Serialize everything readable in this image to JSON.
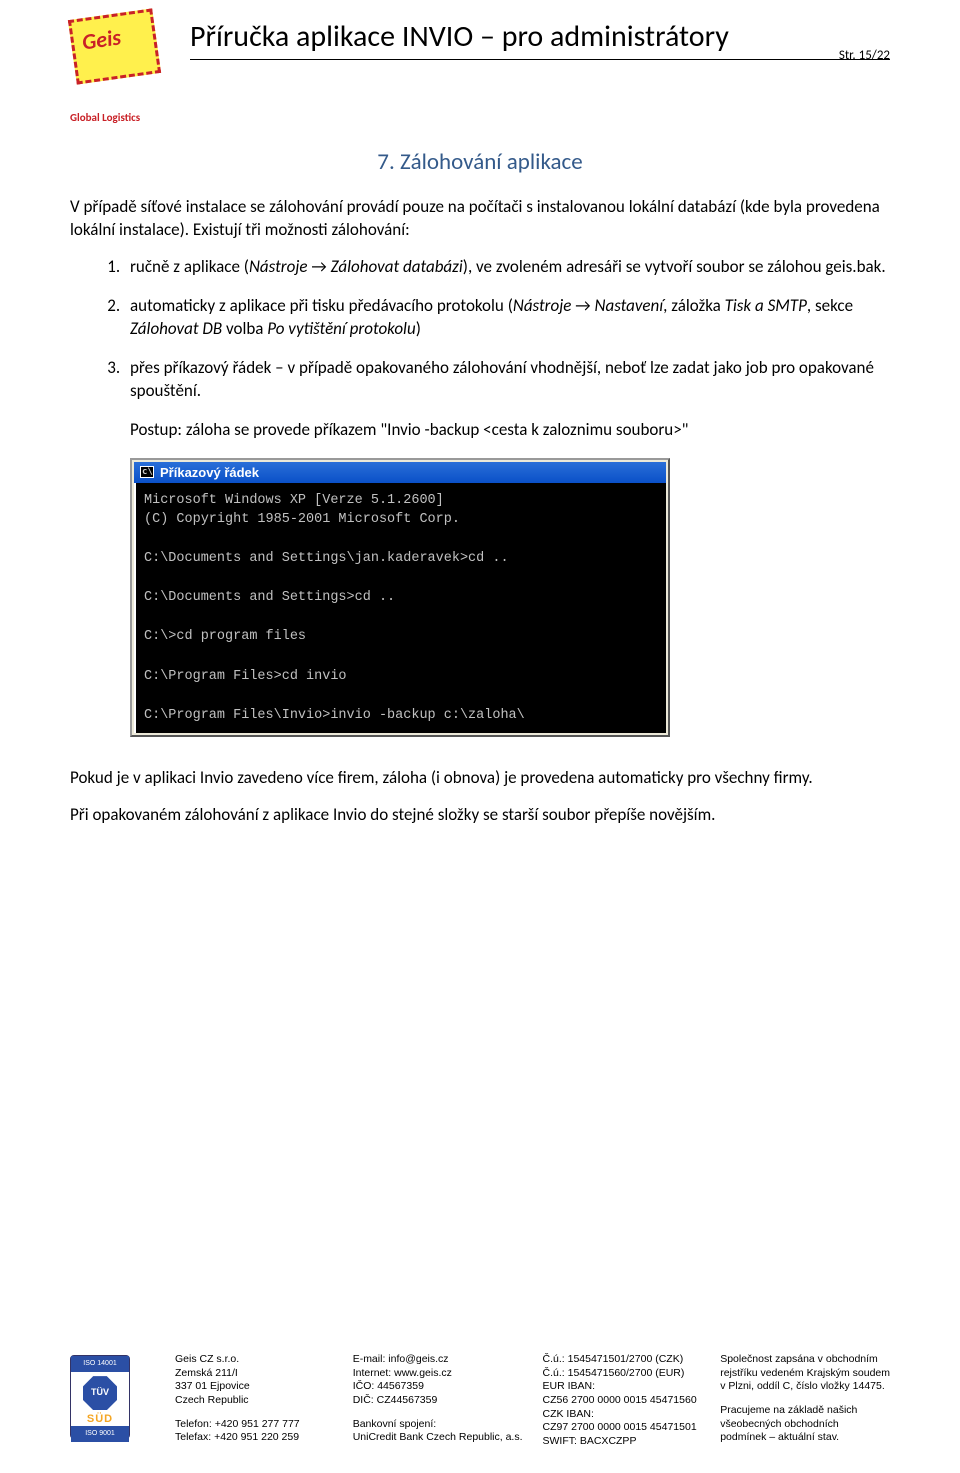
{
  "header": {
    "logo_name": "Geis",
    "logo_sub": "Global Logistics",
    "title": "Příručka aplikace INVIO – pro administrátory",
    "page_label": "Str. 15/22"
  },
  "section": {
    "heading": "7. Zálohování aplikace",
    "intro": "V případě síťové instalace se zálohování provádí pouze na počítači s instalovanou lokální databází (kde byla provedena lokální instalace). Existují tři možnosti zálohování:",
    "item1_a": "ručně z aplikace (",
    "item1_b": "Nástroje",
    "item1_c": " → ",
    "item1_d": "Zálohovat databázi",
    "item1_e": "), ve zvoleném adresáři se vytvoří soubor se zálohou geis.bak.",
    "item2_a": "automaticky z aplikace při tisku předávacího protokolu (",
    "item2_b": "Nástroje",
    "item2_c": " → ",
    "item2_d": "Nastavení",
    "item2_e": ", záložka ",
    "item2_f": "Tisk a SMTP",
    "item2_g": ", sekce ",
    "item2_h": "Zálohovat DB",
    "item2_i": " volba ",
    "item2_j": "Po vytištění protokolu",
    "item2_k": ")",
    "item3": "přes příkazový řádek – v případě opakovaného zálohování vhodnější, neboť lze zadat jako job pro opakované spouštění.",
    "postup": "Postup: záloha se provede příkazem \"Invio  -backup  <cesta k zaloznimu souboru>\"",
    "after1": "Pokud je v aplikaci Invio zavedeno více firem, záloha (i obnova) je provedena automaticky pro všechny firmy.",
    "after2": "Při opakovaném zálohování z aplikace Invio do stejné složky se starší soubor přepíše novějším."
  },
  "cmd": {
    "title": "Příkazový řádek",
    "lines": "Microsoft Windows XP [Verze 5.1.2600]\n(C) Copyright 1985-2001 Microsoft Corp.\n\nC:\\Documents and Settings\\jan.kaderavek>cd ..\n\nC:\\Documents and Settings>cd ..\n\nC:\\>cd program files\n\nC:\\Program Files>cd invio\n\nC:\\Program Files\\Invio>invio -backup c:\\zaloha\\"
  },
  "footer": {
    "tuv_top": "ISO 14001",
    "tuv_mid": "TÜV",
    "tuv_sud": "SÜD",
    "tuv_bot": "ISO 9001",
    "col1": {
      "l1": "Geis CZ s.r.o.",
      "l2": "Zemská 211/I",
      "l3": "337 01 Ejpovice",
      "l4": "Czech Republic",
      "l5": "Telefon: +420 951 277 777",
      "l6": "Telefax: +420 951 220 259"
    },
    "col2": {
      "l1": "E-mail: info@geis.cz",
      "l2": "Internet: www.geis.cz",
      "l3": "IČO: 44567359",
      "l4": "DIČ: CZ44567359",
      "l5": "Bankovní spojení:",
      "l6": "UniCredit Bank Czech Republic, a.s."
    },
    "col3": {
      "l1": "Č.ú.: 1545471501/2700 (CZK)",
      "l2": "Č.ú.: 1545471560/2700 (EUR)",
      "l3": "EUR IBAN:",
      "l4": "CZ56 2700 0000 0015 45471560",
      "l5": "CZK IBAN:",
      "l6": "CZ97 2700 0000 0015 45471501",
      "l7": "SWIFT: BACXCZPP"
    },
    "col4": {
      "l1": "Společnost zapsána v obchodním",
      "l2": "rejstříku vedeném Krajským soudem",
      "l3": "v Plzni, oddíl C, číslo vložky 14475.",
      "l4": "Pracujeme na základě našich",
      "l5": "všeobecných obchodních",
      "l6": "podmínek – aktuální stav."
    }
  }
}
